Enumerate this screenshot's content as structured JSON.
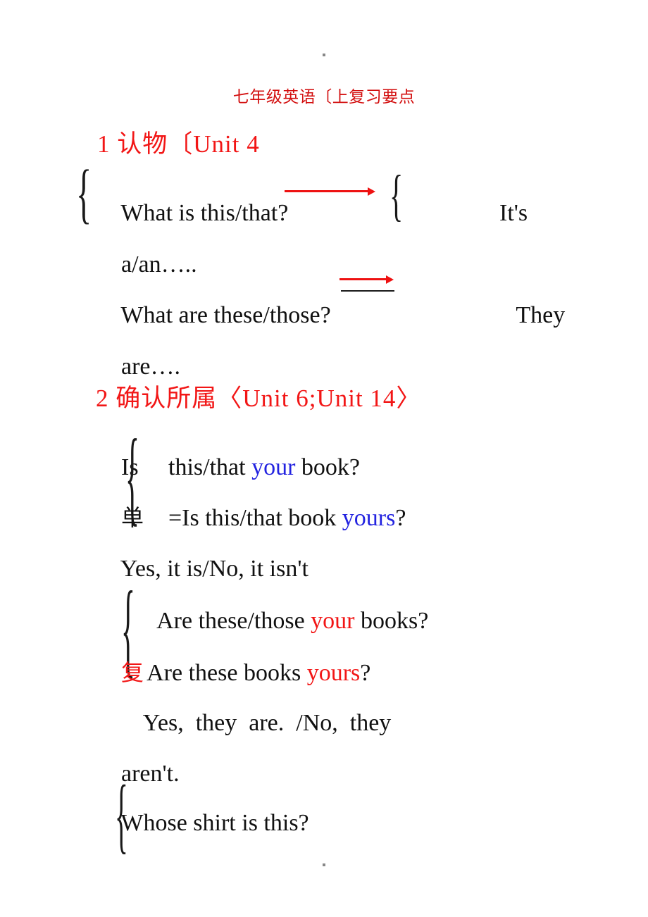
{
  "document": {
    "title": "七年级英语〔上复习要点",
    "page_background": "#ffffff",
    "colors": {
      "red": "#f21616",
      "blue": "#2323e0",
      "black": "#111111",
      "title_red": "#d31010"
    }
  },
  "sections": [
    {
      "number": "1",
      "heading_cn": "认物",
      "heading_ref": "〔Unit 4",
      "heading_full": "1 认物〔Unit 4",
      "lines": [
        {
          "id": "l1a",
          "text": "What is this/that?",
          "note": "red arrow struck through 'that?'"
        },
        {
          "id": "l1b",
          "text": "It's"
        },
        {
          "id": "l1c",
          "text": "a/an….."
        },
        {
          "id": "l1d",
          "text": "What are these/those?",
          "note": "red arrow above 'hose'"
        },
        {
          "id": "l1e",
          "text": "They"
        },
        {
          "id": "l1f",
          "text": "are…."
        }
      ]
    },
    {
      "number": "2",
      "heading_cn": "确认所属",
      "heading_ref": "〈Unit 6;Unit 14〉",
      "heading_full": "2 确认所属〈Unit 6;Unit 14〉",
      "lines": [
        {
          "id": "l2a",
          "prefix": "Is",
          "text_before": "this/that ",
          "highlight": "your",
          "highlight_color": "blue",
          "text_after": " book?"
        },
        {
          "id": "l2b",
          "marker": "单",
          "marker_color": "black",
          "text_before": "=Is this/that book ",
          "highlight": "yours",
          "highlight_color": "blue",
          "text_after": "?"
        },
        {
          "id": "l2c",
          "text": "Yes, it is/No, it isn't"
        },
        {
          "id": "l2d",
          "text_before": "Are these/those ",
          "highlight": "your",
          "highlight_color": "red",
          "text_after": " books?"
        },
        {
          "id": "l2e",
          "marker": "复",
          "marker_color": "red",
          "text_before": "Are these books ",
          "highlight": "yours",
          "highlight_color": "red",
          "text_after": "?"
        },
        {
          "id": "l2f",
          "text": "Yes,  they  are.  /No,  they"
        },
        {
          "id": "l2g",
          "text": "aren't."
        },
        {
          "id": "l2h",
          "text": "Whose shirt is this?"
        }
      ]
    }
  ],
  "glyphs": {
    "brace_open": "{",
    "brace_tall": "{"
  }
}
